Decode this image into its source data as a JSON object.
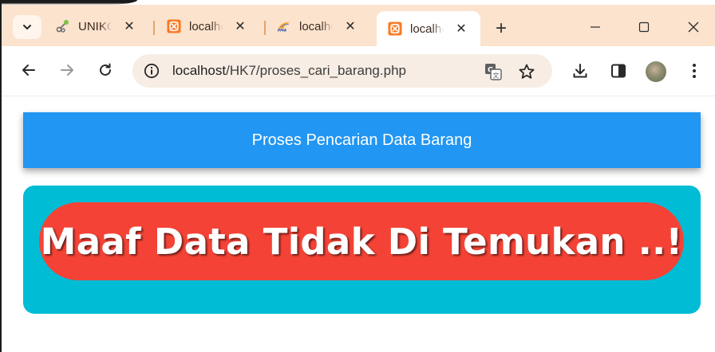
{
  "browser": {
    "tabs": [
      {
        "title": "UNIKOM",
        "favicon": "network-icon",
        "active": false
      },
      {
        "title": "localhost",
        "favicon": "xampp-icon",
        "active": false
      },
      {
        "title": "localhost",
        "favicon": "phpmyadmin-icon",
        "active": false
      },
      {
        "title": "localhost",
        "favicon": "xampp-icon",
        "active": true
      }
    ],
    "new_tab_label": "+",
    "url_host": "localhost",
    "url_path": "/HK7/proses_cari_barang.php",
    "colors": {
      "tabstrip_bg": "#fbe3ce",
      "omnibox_bg": "#f7ede4",
      "xampp_orange": "#fb7a24"
    }
  },
  "page": {
    "header_title": "Proses Pencarian Data Barang",
    "alert_message": "Maaf Data Tidak Di Temukan ..!",
    "colors": {
      "header_bg": "#2196f3",
      "card_bg": "#00bcd4",
      "alert_bg": "#f44336"
    }
  }
}
